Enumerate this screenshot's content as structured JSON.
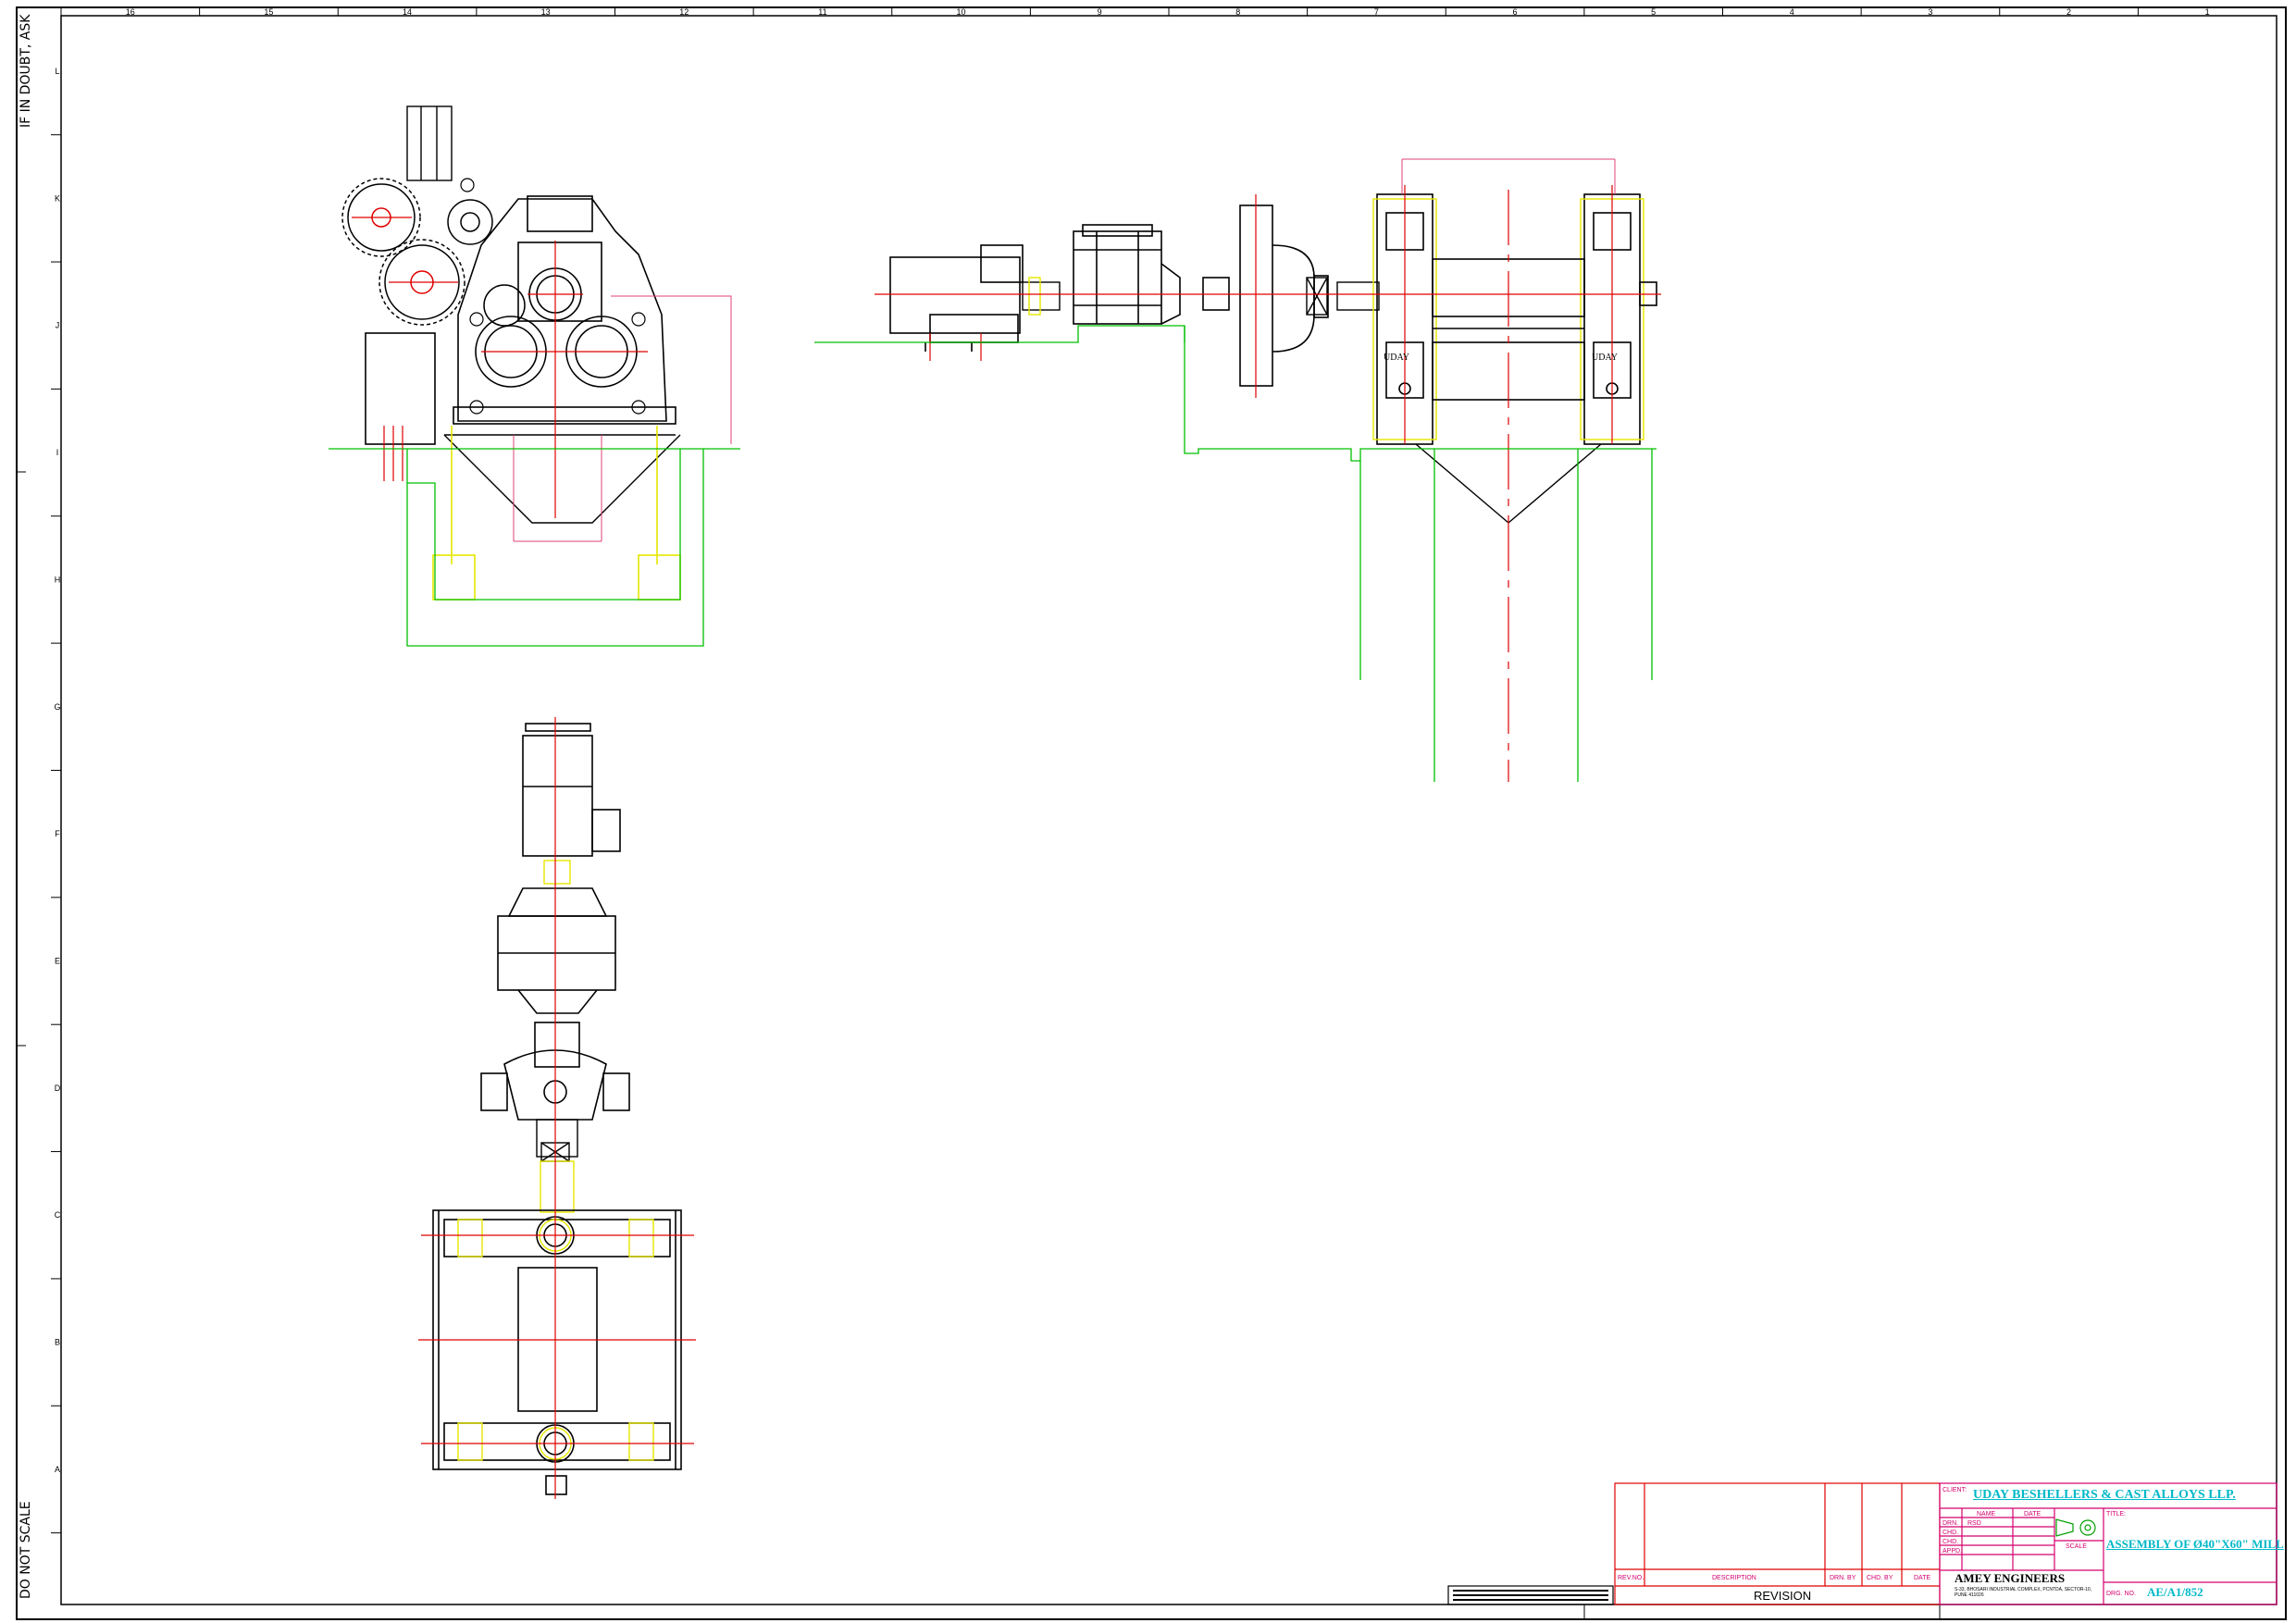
{
  "sheet": {
    "top_columns": [
      "16",
      "15",
      "14",
      "13",
      "12",
      "11",
      "10",
      "9",
      "8",
      "7",
      "6",
      "5",
      "4",
      "3",
      "2",
      "1"
    ],
    "side_rows": [
      "L",
      "K",
      "J",
      "I",
      "H",
      "G",
      "F",
      "E",
      "D",
      "C",
      "B",
      "A"
    ],
    "note_top_left": "IF IN DOUBT, ASK",
    "note_bottom_left": "DO NOT SCALE"
  },
  "drawing_labels": {
    "mill_stand_left": "UDAY",
    "mill_stand_right": "UDAY"
  },
  "title_block": {
    "client_label": "CLIENT:",
    "client_name": "UDAY BESHELLERS & CAST ALLOYS LLP.",
    "name_header": "NAME",
    "date_header": "DATE",
    "rows": [
      "DRN.",
      "CHD.",
      "CHD.",
      "APPD."
    ],
    "drn_name": "RSD",
    "title_label": "TITLE:",
    "title": "ASSEMBLY OF Ø40\"X60\" MILL",
    "scale_label": "SCALE",
    "company_name": "AMEY ENGINEERS",
    "company_address": "S-33, BHOSARI INDUSTRIAL COMPLEX, PCNTDA, SECTOR-10, PUNE 411026",
    "drg_no_label": "DRG. NO.",
    "drg_no": "AE/A1/852",
    "revision": {
      "rev_no": "REV.NO.",
      "description": "DESCRIPTION",
      "drn_by": "DRN. BY",
      "chd_by": "CHD. BY",
      "date": "DATE",
      "footer": "REVISION"
    }
  },
  "colors": {
    "frame": "#000000",
    "centerline": "#e00000",
    "foundation": "#00c000",
    "highlight": "#e6e600",
    "dimension": "#e0407a",
    "title_text": "#00b8c8"
  }
}
